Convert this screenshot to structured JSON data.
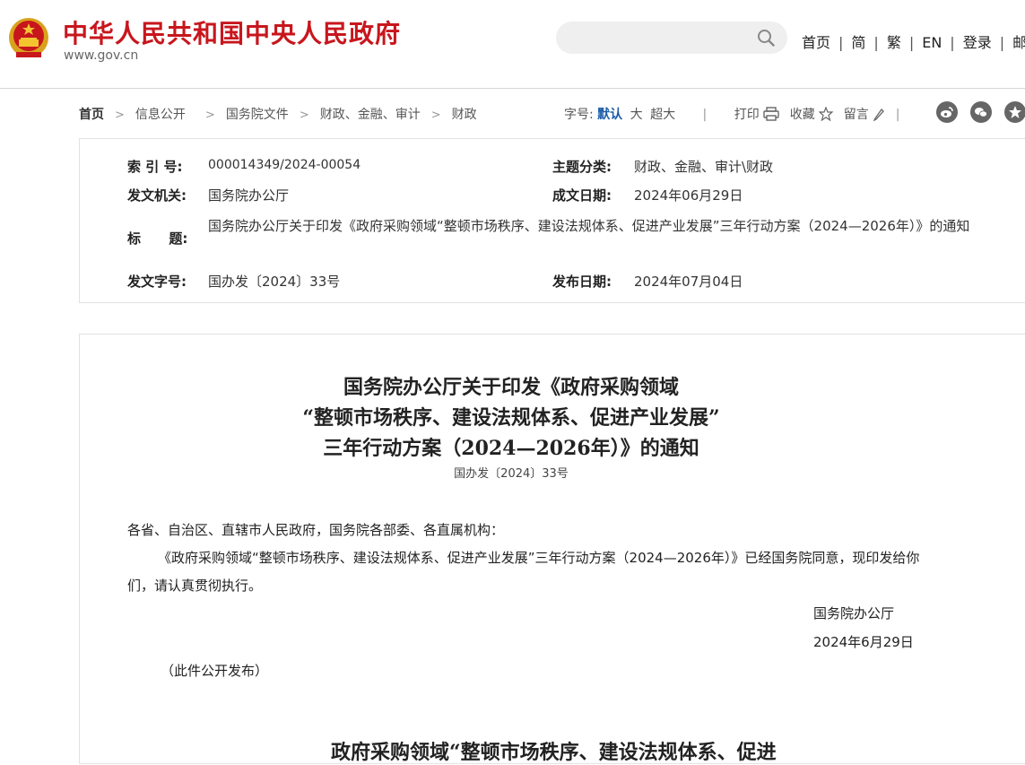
{
  "header": {
    "site_title": "中华人民共和国中央人民政府",
    "site_domain": "www.gov.cn",
    "search": {
      "placeholder": ""
    },
    "nav": [
      "首页",
      "简",
      "繁",
      "EN",
      "登录",
      "邮箱"
    ]
  },
  "breadcrumb": [
    "首页",
    "信息公开",
    "国务院文件",
    "财政、金融、审计",
    "财政"
  ],
  "toolbar": {
    "font_size_label": "字号:",
    "font_sizes": [
      "默认",
      "大",
      "超大"
    ],
    "print": "打印",
    "favorite": "收藏",
    "comment": "留言"
  },
  "share_icons": [
    "weibo-icon",
    "wechat-icon",
    "qzone-icon"
  ],
  "meta": {
    "index_label": "索 引 号:",
    "index_value": "000014349/2024-00054",
    "category_label": "主题分类:",
    "category_value": "财政、金融、审计\\财政",
    "issuer_label": "发文机关:",
    "issuer_value": "国务院办公厅",
    "created_label": "成文日期:",
    "created_value": "2024年06月29日",
    "title_label": "标      题:",
    "title_value": "国务院办公厅关于印发《政府采购领域“整顿市场秩序、建设法规体系、促进产业发展”三年行动方案（2024—2026年）》的通知",
    "docno_label": "发文字号:",
    "docno_value": "国办发〔2024〕33号",
    "published_label": "发布日期:",
    "published_value": "2024年07月04日"
  },
  "article": {
    "title_lines": [
      "国务院办公厅关于印发《政府采购领域",
      "“整顿市场秩序、建设法规体系、促进产业发展”",
      "三年行动方案（2024—2026年）》的通知"
    ],
    "doc_number": "国办发〔2024〕33号",
    "salutation": "各省、自治区、直辖市人民政府，国务院各部委、各直属机构：",
    "body": "《政府采购领域“整顿市场秩序、建设法规体系、促进产业发展”三年行动方案（2024—2026年）》已经国务院同意，现印发给你们，请认真贯彻执行。",
    "signer": "国务院办公厅",
    "sign_date": "2024年6月29日",
    "note": "（此件公开发布）",
    "next_heading": "政府采购领域“整顿市场秩序、建设法规体系、促进"
  }
}
